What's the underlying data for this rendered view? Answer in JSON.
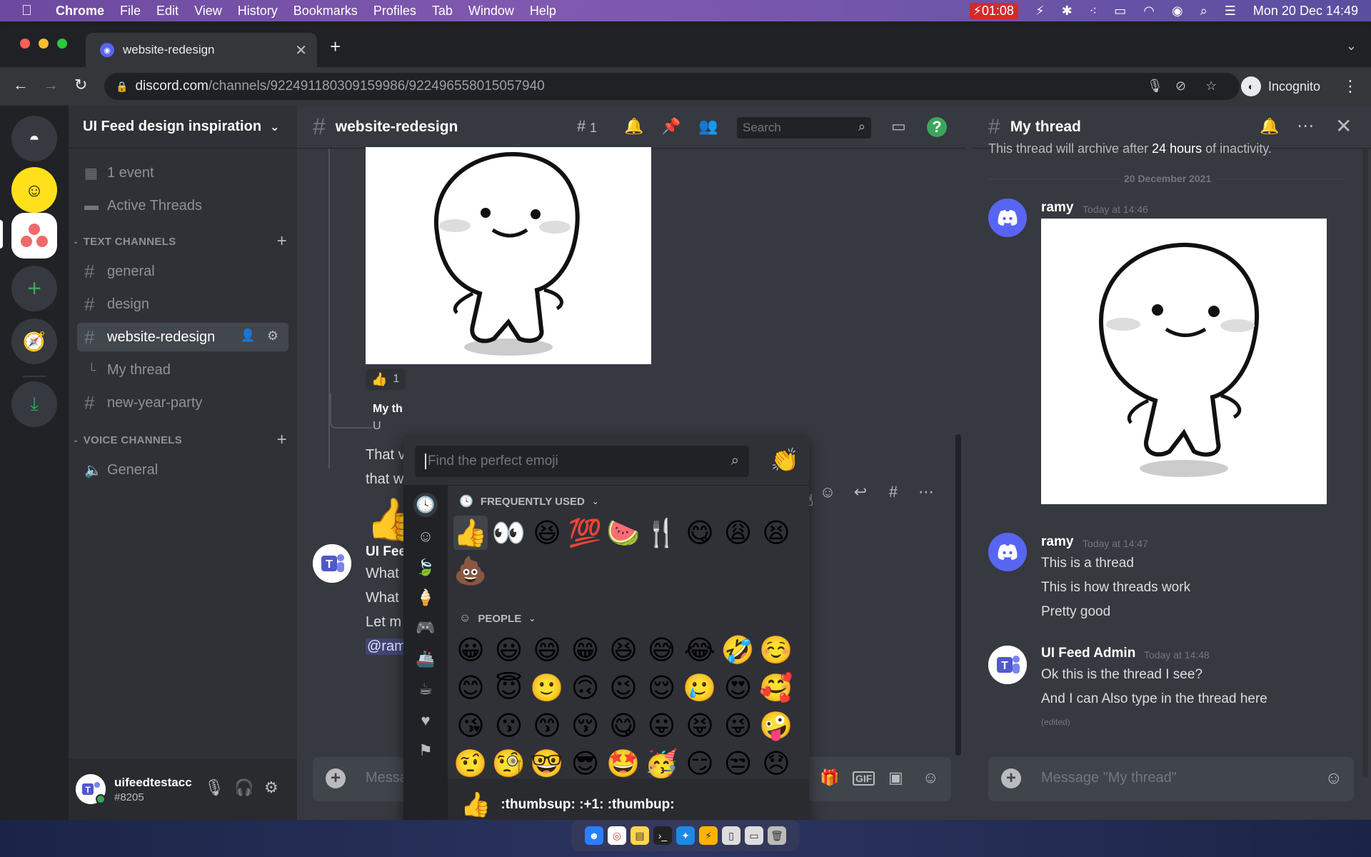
{
  "menubar": {
    "app": "Chrome",
    "items": [
      "File",
      "Edit",
      "View",
      "History",
      "Bookmarks",
      "Profiles",
      "Tab",
      "Window",
      "Help"
    ],
    "battery_time": "01:08",
    "datetime": "Mon 20 Dec  14:49"
  },
  "browser": {
    "tab_title": "website-redesign",
    "url_host": "discord.com",
    "url_path": "/channels/922491180309159986/922496558015057940",
    "profile": "Incognito"
  },
  "sidebar": {
    "guild_name": "UI Feed design inspiration",
    "events": "1 event",
    "active_threads": "Active Threads",
    "text_category": "TEXT CHANNELS",
    "voice_category": "VOICE CHANNELS",
    "channels": [
      "general",
      "design",
      "website-redesign",
      "My thread",
      "new-year-party"
    ],
    "voice_channels": [
      "General"
    ]
  },
  "user_panel": {
    "username": "uifeedtestacc",
    "tag": "#8205"
  },
  "chat": {
    "channel_name": "website-redesign",
    "threads_count": "1",
    "search_placeholder": "Search",
    "reaction_count": "1",
    "thread_preview_name": "My th",
    "thread_preview_user": "U",
    "partial_lines": [
      "That v",
      "that w"
    ],
    "message2_author": "UI Fee",
    "message2_lines": [
      "What",
      "What",
      "Let m"
    ],
    "message2_mention": "@ram",
    "composer_placeholder": "Messa"
  },
  "thread": {
    "title": "My thread",
    "archive_prefix": "This thread will archive after ",
    "archive_bold": "24 hours",
    "archive_suffix": " of inactivity.",
    "date_divider": "20 December 2021",
    "messages": [
      {
        "author": "ramy",
        "time": "Today at 14:46"
      },
      {
        "author": "ramy",
        "time": "Today at 14:47",
        "lines": [
          "This is a thread",
          "This is how threads work",
          "Pretty good"
        ]
      },
      {
        "author": "UI Feed Admin",
        "time": "Today at 14:48",
        "lines": [
          "Ok this is the thread I see?",
          "And I can Also type in the thread here"
        ],
        "edited": "(edited)"
      }
    ],
    "composer_placeholder": "Message \"My thread\""
  },
  "emoji_picker": {
    "search_placeholder": "Find the perfect emoji",
    "frequently_used_label": "FREQUENTLY USED",
    "people_label": "PEOPLE",
    "frequently_used": [
      "👍",
      "👀",
      "😆",
      "💯",
      "🍉",
      "🍴",
      "😋",
      "😩",
      "😫",
      "💩"
    ],
    "people": [
      "😀",
      "😃",
      "😄",
      "😁",
      "😆",
      "😅",
      "😂",
      "🤣",
      "☺️",
      "😊",
      "😇",
      "🙂",
      "🙃",
      "😉",
      "😌",
      "🥲",
      "😍",
      "🥰",
      "😘",
      "😗",
      "😙",
      "😚",
      "😋",
      "😛",
      "😝",
      "😜",
      "🤪",
      "🤨",
      "🧐",
      "🤓",
      "😎",
      "🤩",
      "🥳",
      "😏",
      "😒",
      "😞"
    ],
    "footer_emoji": "👍",
    "footer_label": ":thumbsup: :+1: :thumbup:"
  },
  "colors": {
    "blurple": "#5865f2",
    "green": "#3ba55d",
    "bg_primary": "#36393f",
    "bg_secondary": "#2f3136",
    "bg_tertiary": "#202225"
  }
}
